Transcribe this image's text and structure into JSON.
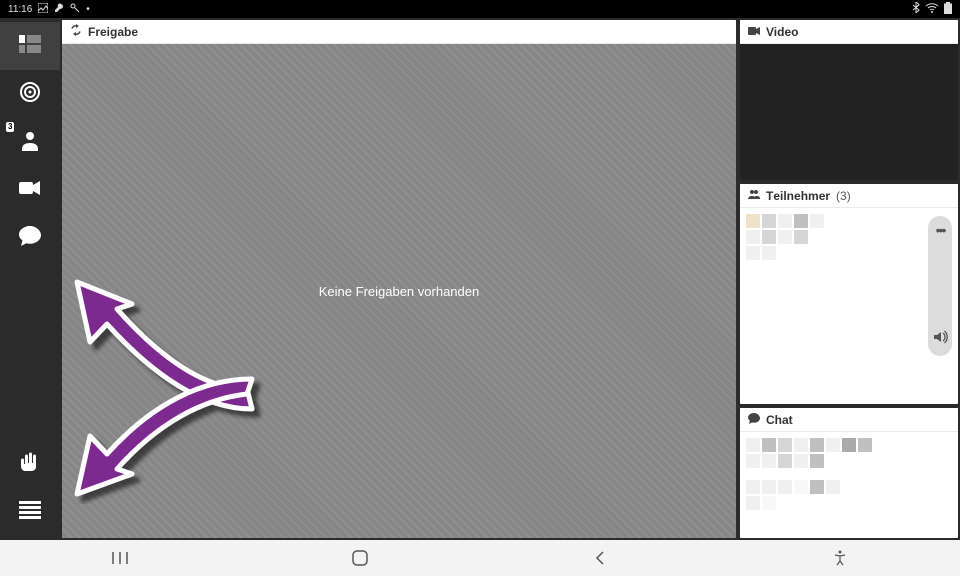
{
  "statusbar": {
    "time": "11:16",
    "left_icons": [
      "image-icon",
      "wrench-icon",
      "key-icon",
      "dot-icon"
    ],
    "right_icons": [
      "bluetooth-icon",
      "wifi-icon",
      "battery-icon"
    ]
  },
  "sidebar": {
    "items": [
      {
        "name": "dashboard",
        "icon": "grid-icon",
        "active": true
      },
      {
        "name": "target",
        "icon": "target-icon"
      },
      {
        "name": "participants",
        "icon": "person-icon",
        "badge": "3"
      },
      {
        "name": "video",
        "icon": "camera-icon"
      },
      {
        "name": "chat",
        "icon": "chat-icon"
      }
    ],
    "bottom_items": [
      {
        "name": "raise-hand",
        "icon": "hand-icon"
      },
      {
        "name": "menu",
        "icon": "menu-icon"
      }
    ]
  },
  "panels": {
    "freigabe": {
      "title": "Freigabe",
      "header_icon": "sync-icon",
      "empty_message": "Keine Freigaben vorhanden"
    },
    "video": {
      "title": "Video",
      "header_icon": "camera-icon"
    },
    "teilnehmer": {
      "title": "Teilnehmer",
      "header_icon": "people-icon",
      "count": "(3)",
      "more_icon": "more-icon",
      "volume_icon": "speaker-icon"
    },
    "chat": {
      "title": "Chat",
      "header_icon": "chat-bubble-icon"
    }
  },
  "navbar": {
    "recent": "recent-icon",
    "home": "home-icon",
    "back": "back-icon",
    "a11y": "accessibility-icon"
  }
}
